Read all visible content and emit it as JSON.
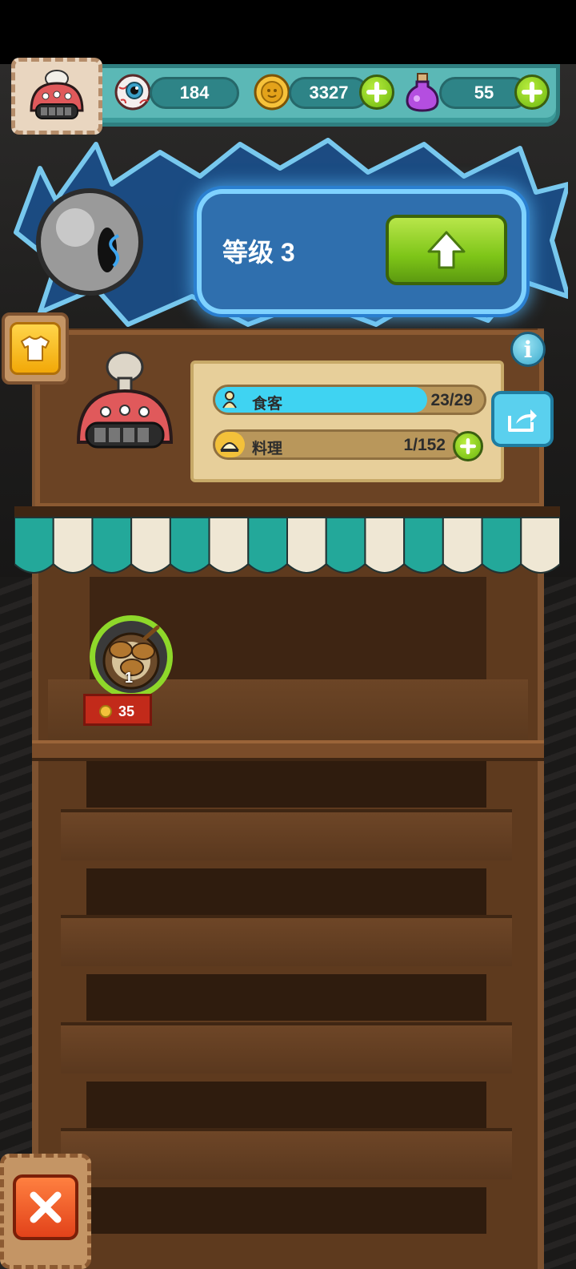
{
  "resources": {
    "eyes": {
      "icon": "eyeball-icon",
      "value": "184"
    },
    "coins": {
      "icon": "coin-icon",
      "value": "3327"
    },
    "potions": {
      "icon": "potion-icon",
      "value": "55"
    }
  },
  "level": {
    "label": "等级 3"
  },
  "shop": {
    "customers": {
      "label": "食客",
      "value": "23/29",
      "progress": 0.79
    },
    "dishes": {
      "label": "料理",
      "value": "1/152",
      "progress": 0.0
    }
  },
  "dish": {
    "count": "1",
    "price": "35"
  },
  "colors": {
    "teal_bar": "#5bb8b6",
    "accent_green": "#8ed82a",
    "customer_bar": "#3fd3f2",
    "close_orange": "#e2421a"
  }
}
